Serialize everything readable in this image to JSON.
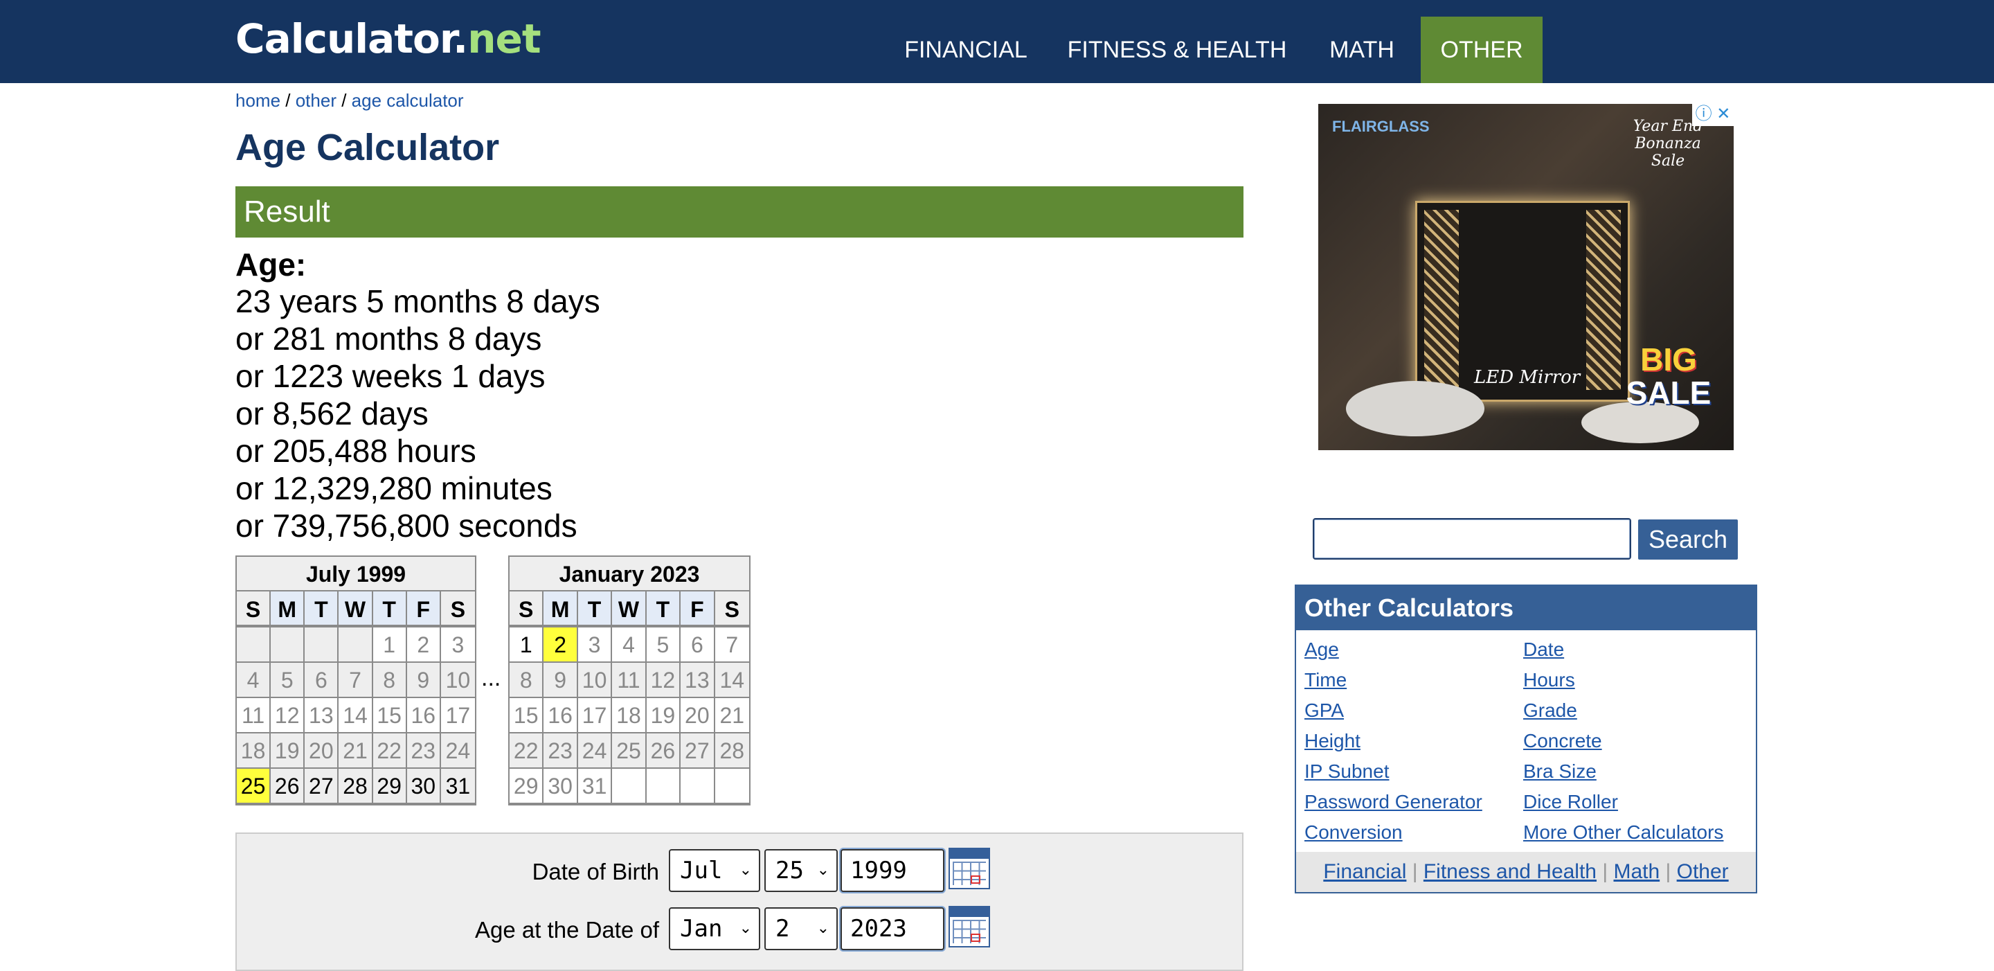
{
  "header": {
    "logo_main": "Calculator.",
    "logo_accent": "net",
    "nav": [
      "FINANCIAL",
      "FITNESS & HEALTH",
      "MATH",
      "OTHER"
    ],
    "active_nav": "OTHER",
    "colors": {
      "topbar": "#153460",
      "active": "#5f8a34",
      "logo_accent": "#a5e07e"
    }
  },
  "breadcrumb": {
    "home": "home",
    "sep": " / ",
    "other": "other",
    "current": "age calculator"
  },
  "page_title": "Age Calculator",
  "result": {
    "heading": "Result",
    "age_label": "Age:",
    "lines": [
      "23 years 5 months 8 days",
      "or 281 months 8 days",
      "or 1223 weeks 1 days",
      "or 8,562 days",
      "or 205,488 hours",
      "or 12,329,280 minutes",
      "or 739,756,800 seconds"
    ]
  },
  "calendars": {
    "weekdays": [
      "S",
      "M",
      "T",
      "W",
      "T",
      "F",
      "S"
    ],
    "ellipsis": "...",
    "start": {
      "title": "July 1999",
      "days": [
        "",
        "",
        "",
        "",
        "1",
        "2",
        "3",
        "4",
        "5",
        "6",
        "7",
        "8",
        "9",
        "10",
        "11",
        "12",
        "13",
        "14",
        "15",
        "16",
        "17",
        "18",
        "19",
        "20",
        "21",
        "22",
        "23",
        "24",
        "25",
        "26",
        "27",
        "28",
        "29",
        "30",
        "31"
      ],
      "highlight": "25"
    },
    "end": {
      "title": "January 2023",
      "days": [
        "1",
        "2",
        "3",
        "4",
        "5",
        "6",
        "7",
        "8",
        "9",
        "10",
        "11",
        "12",
        "13",
        "14",
        "15",
        "16",
        "17",
        "18",
        "19",
        "20",
        "21",
        "22",
        "23",
        "24",
        "25",
        "26",
        "27",
        "28",
        "29",
        "30",
        "31",
        "",
        "",
        "",
        ""
      ],
      "highlight": "2"
    }
  },
  "form": {
    "dob_label": "Date of Birth",
    "dob_month": "Jul",
    "dob_day": "25",
    "dob_year": "1999",
    "at_label": "Age at the Date of",
    "at_month": "Jan",
    "at_day": "2",
    "at_year": "2023"
  },
  "ad": {
    "brand": "FLAIRGLASS",
    "badge": "Year End Bonanza Sale",
    "product": "LED Mirror",
    "sale_line1": "BIG",
    "sale_line2": "SALE",
    "close": "ⓘ ✕"
  },
  "search": {
    "value": "",
    "button": "Search"
  },
  "other_calculators": {
    "heading": "Other Calculators",
    "left": [
      "Age",
      "Time",
      "GPA",
      "Height",
      "IP Subnet",
      "Password Generator",
      "Conversion"
    ],
    "right": [
      "Date",
      "Hours",
      "Grade",
      "Concrete",
      "Bra Size",
      "Dice Roller",
      "More Other Calculators"
    ],
    "footer": [
      "Financial",
      "Fitness and Health",
      "Math",
      "Other"
    ],
    "footer_sep": " | "
  }
}
